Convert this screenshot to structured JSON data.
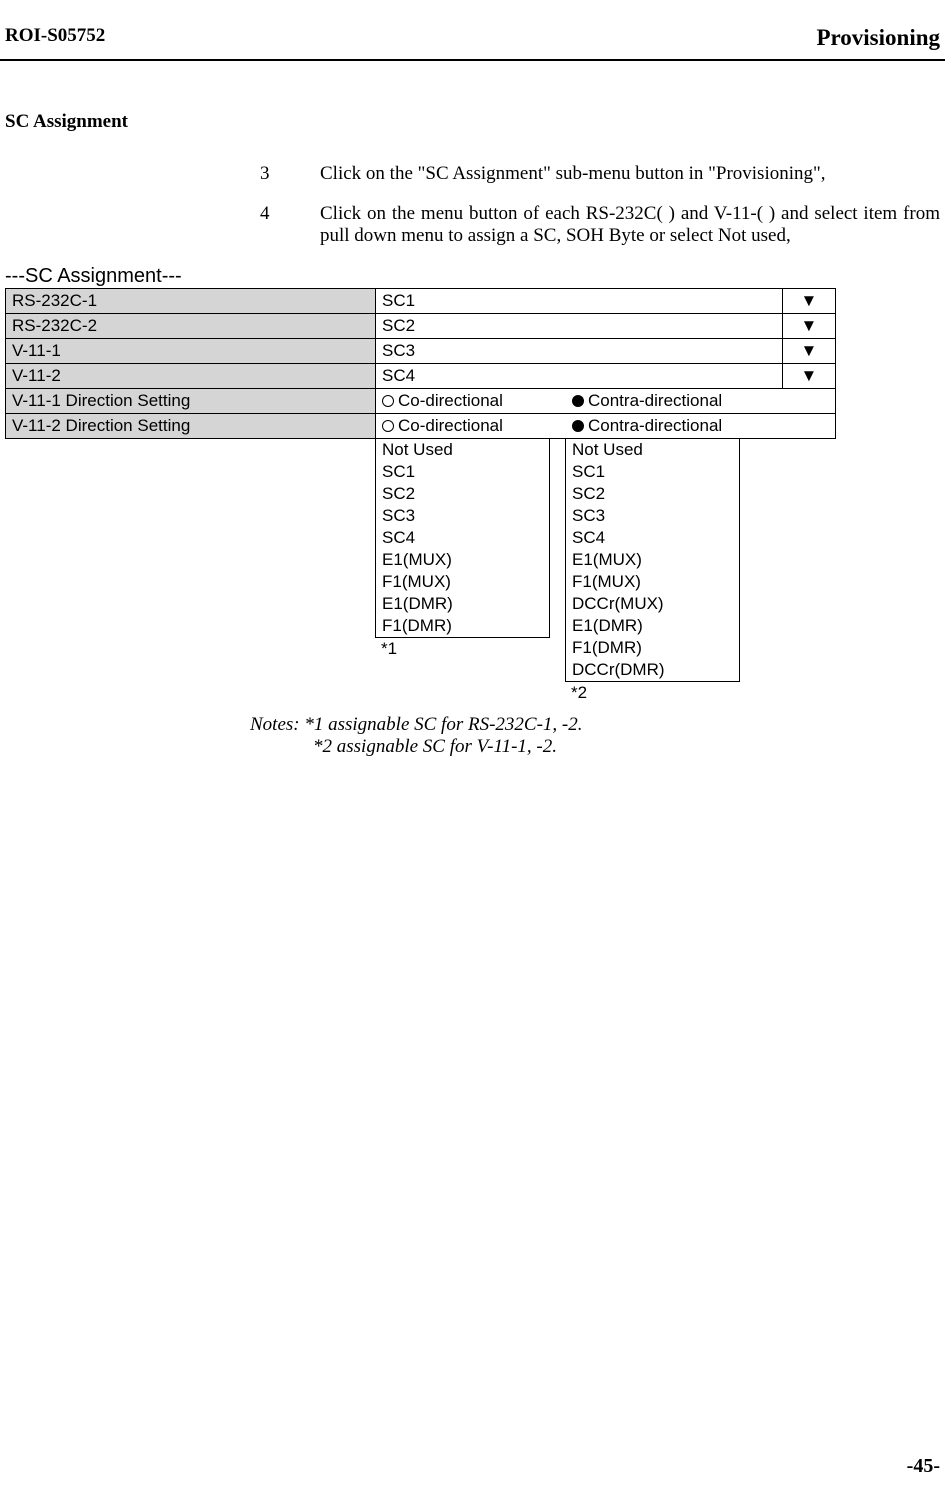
{
  "header": {
    "left": "ROI-S05752",
    "right": "Provisioning"
  },
  "section_title": "SC Assignment",
  "steps": [
    {
      "num": "3",
      "text": "Click on the \"SC Assignment\" sub-menu button in \"Provisioning\","
    },
    {
      "num": "4",
      "text": "Click on the menu button of each RS-232C( ) and V-11-( ) and select item from pull down menu to assign a SC, SOH Byte or select Not used,"
    }
  ],
  "panel_title": "---SC Assignment---",
  "rows": {
    "r1_label": "RS-232C-1",
    "r1_value": "SC1",
    "r2_label": "RS-232C-2",
    "r2_value": "SC2",
    "r3_label": "V-11-1",
    "r3_value": "SC3",
    "r4_label": "V-11-2",
    "r4_value": "SC4",
    "r5_label": "V-11-1 Direction Setting",
    "r6_label": "V-11-2 Direction Setting",
    "co_dir": "Co-directional",
    "contra_dir": "Contra-directional"
  },
  "arrow": "▼",
  "dropdown1": {
    "items": [
      "Not Used",
      "SC1",
      "SC2",
      "SC3",
      "SC4",
      "E1(MUX)",
      "F1(MUX)",
      "E1(DMR)",
      "F1(DMR)"
    ],
    "footer": "*1"
  },
  "dropdown2": {
    "items": [
      "Not Used",
      "SC1",
      "SC2",
      "SC3",
      "SC4",
      "E1(MUX)",
      "F1(MUX)",
      "DCCr(MUX)",
      "E1(DMR)",
      "F1(DMR)",
      "DCCr(DMR)"
    ],
    "footer": "*2"
  },
  "notes": {
    "line1": "Notes:  *1  assignable SC for RS-232C-1, -2.",
    "line2": "*2  assignable SC for V-11-1, -2."
  },
  "page_number": "-45-"
}
